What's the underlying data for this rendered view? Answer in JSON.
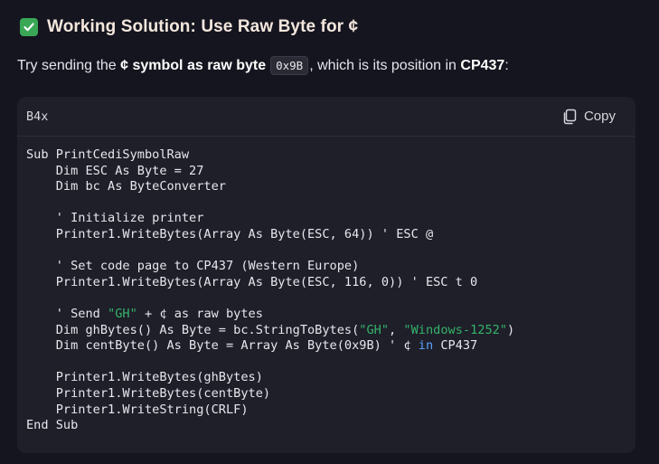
{
  "heading": {
    "icon": "check-mark-icon",
    "icon_color": "#3aa757",
    "text": "Working Solution: Use Raw Byte for ¢"
  },
  "intro": {
    "part1": "Try sending the ",
    "bold1": "¢ symbol as raw byte",
    "code": "0x9B",
    "part2": ", which is its position in ",
    "bold2": "CP437",
    "part3": ":"
  },
  "code_block": {
    "language": "B4x",
    "copy_label": "Copy",
    "lines": [
      [
        {
          "t": "Sub PrintCediSymbolRaw"
        }
      ],
      [
        {
          "t": "    Dim ESC As Byte = 27"
        }
      ],
      [
        {
          "t": "    Dim bc As ByteConverter"
        }
      ],
      [
        {
          "t": ""
        }
      ],
      [
        {
          "t": "    ' Initialize printer"
        }
      ],
      [
        {
          "t": "    Printer1.WriteBytes(Array As Byte(ESC, 64)) ' ESC @"
        }
      ],
      [
        {
          "t": ""
        }
      ],
      [
        {
          "t": "    ' Set code page to CP437 (Western Europe)"
        }
      ],
      [
        {
          "t": "    Printer1.WriteBytes(Array As Byte(ESC, 116, 0)) ' ESC t 0"
        }
      ],
      [
        {
          "t": ""
        }
      ],
      [
        {
          "t": "    ' Send "
        },
        {
          "t": "\"GH\"",
          "c": "string"
        },
        {
          "t": " + ¢ as raw bytes"
        }
      ],
      [
        {
          "t": "    Dim ghBytes() As Byte = bc.StringToBytes("
        },
        {
          "t": "\"GH\"",
          "c": "string"
        },
        {
          "t": ", "
        },
        {
          "t": "\"Windows-1252\"",
          "c": "string"
        },
        {
          "t": ")"
        }
      ],
      [
        {
          "t": "    Dim centByte() As Byte = Array As Byte(0x9B) ' ¢ "
        },
        {
          "t": "in",
          "c": "keyword"
        },
        {
          "t": " CP437"
        }
      ],
      [
        {
          "t": ""
        }
      ],
      [
        {
          "t": "    Printer1.WriteBytes(ghBytes)"
        }
      ],
      [
        {
          "t": "    Printer1.WriteBytes(centByte)"
        }
      ],
      [
        {
          "t": "    Printer1.WriteString(CRLF)"
        }
      ],
      [
        {
          "t": "End Sub"
        }
      ]
    ]
  }
}
